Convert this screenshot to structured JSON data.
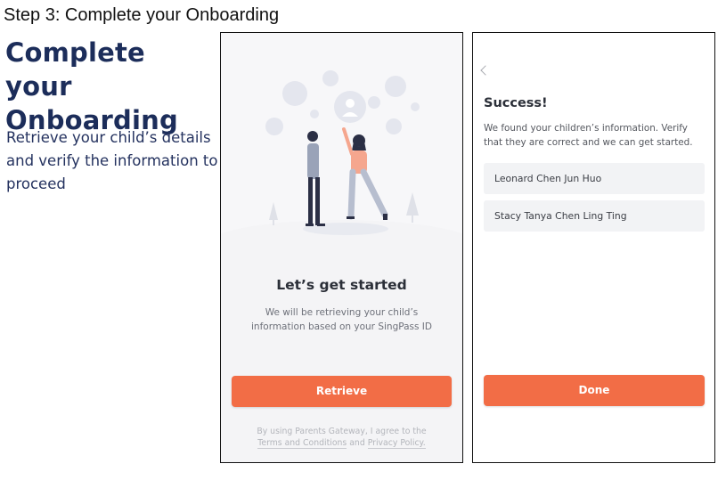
{
  "step_title": "Step 3: Complete your Onboarding",
  "heading": "Complete your Onboarding",
  "description": "Retrieve your child’s details and verify the information to proceed",
  "left_screen": {
    "heading": "Let’s get started",
    "description": "We will be retrieving your child’s information based on your SingPass ID",
    "retrieve_button": "Retrieve",
    "terms": {
      "prefix": "By using Parents Gateway, I agree to the",
      "terms_link": "Terms and Conditions",
      "and": "and",
      "privacy_link": "Privacy Policy",
      "suffix": "."
    }
  },
  "right_screen": {
    "back_icon": "chevron-left-icon",
    "heading": "Success!",
    "description": "We found your children’s information. Verify that they are correct and we can get started.",
    "children": [
      {
        "name": "Leonard Chen Jun Huo"
      },
      {
        "name": "Stacy Tanya Chen Ling Ting"
      }
    ],
    "done_button": "Done"
  },
  "colors": {
    "accent": "#f26d46",
    "heading_navy": "#1c2d5a",
    "bubble": "#e3e5ec"
  }
}
